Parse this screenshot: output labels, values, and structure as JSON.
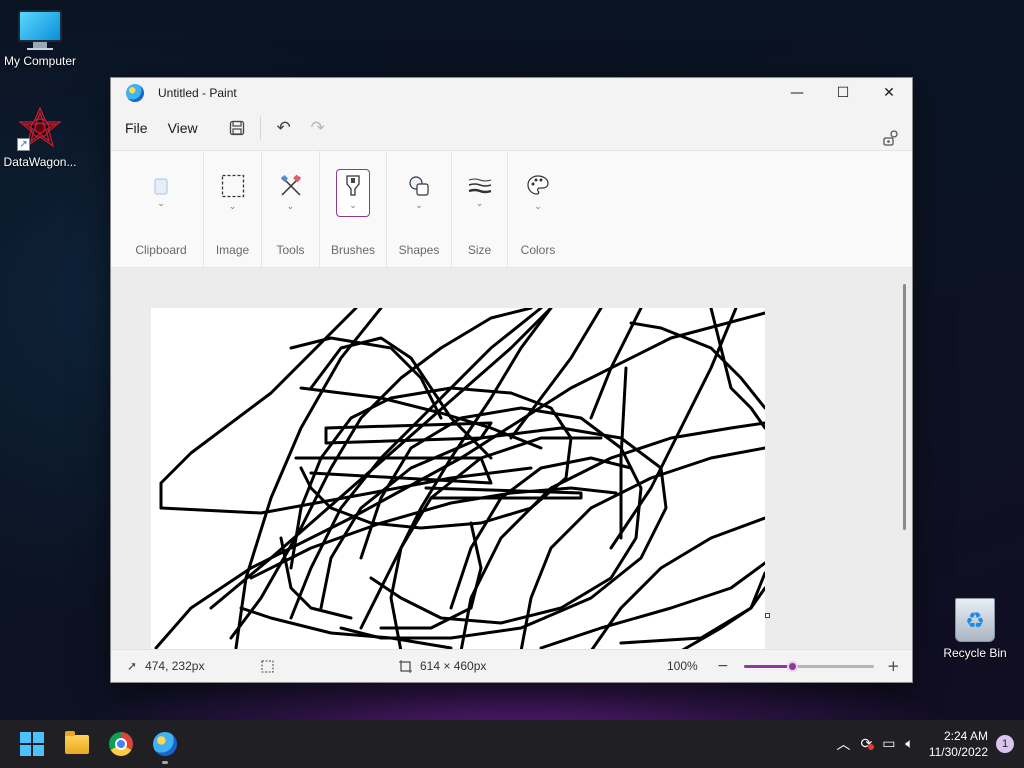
{
  "desktop": {
    "icons": [
      {
        "label": "My Computer",
        "icon": "computer-icon"
      },
      {
        "label": "DataWagon...",
        "icon": "datawagon-icon"
      },
      {
        "label": "Recycle Bin",
        "icon": "recycle-bin-icon"
      }
    ]
  },
  "window": {
    "title": "Untitled - Paint",
    "controls": {
      "minimize": "—",
      "maximize": "☐",
      "close": "✕"
    }
  },
  "menubar": {
    "file": "File",
    "view": "View",
    "save_icon": "💾",
    "undo_icon": "↶",
    "redo_icon": "↷",
    "account_icon": "⚙"
  },
  "ribbon": {
    "groups": [
      {
        "label": "Clipboard",
        "icon": "clipboard-icon"
      },
      {
        "label": "Image",
        "icon": "select-rectangle-icon"
      },
      {
        "label": "Tools",
        "icon": "tools-icon"
      },
      {
        "label": "Brushes",
        "icon": "brush-icon"
      },
      {
        "label": "Shapes",
        "icon": "shapes-icon"
      },
      {
        "label": "Size",
        "icon": "size-icon"
      },
      {
        "label": "Colors",
        "icon": "palette-icon"
      }
    ]
  },
  "statusbar": {
    "cursor_position": "474, 232px",
    "canvas_size": "614 × 460px",
    "zoom": "100%",
    "zoom_minus": "−",
    "zoom_plus": "+",
    "zoom_level": 0.38
  },
  "taskbar": {
    "apps": [
      "start-icon",
      "file-explorer-icon",
      "chrome-icon",
      "paint-icon"
    ],
    "time": "2:24 AM",
    "date": "11/30/2022",
    "notifications": "1"
  }
}
